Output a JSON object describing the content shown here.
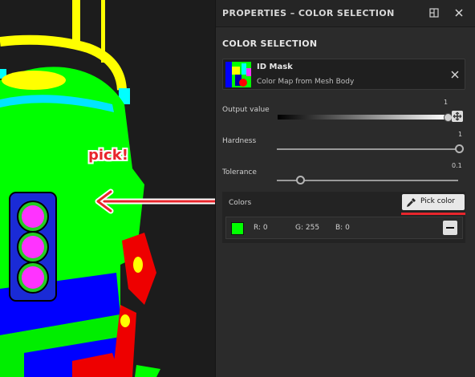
{
  "annotation": {
    "text": "pick!"
  },
  "panel": {
    "title": "PROPERTIES – COLOR SELECTION",
    "section_title": "COLOR SELECTION",
    "resource": {
      "name": "ID Mask",
      "description": "Color Map from Mesh Body"
    },
    "output_value": {
      "label": "Output value",
      "value": "1"
    },
    "hardness": {
      "label": "Hardness",
      "value": "1"
    },
    "tolerance": {
      "label": "Tolerance",
      "value": "0.1"
    },
    "colors": {
      "label": "Colors",
      "pick_button": "Pick color",
      "entry": {
        "r": "R: 0",
        "g": "G: 255",
        "b": "B: 0",
        "swatch": "#00ff00"
      }
    }
  },
  "accent_color": "#e8262c"
}
